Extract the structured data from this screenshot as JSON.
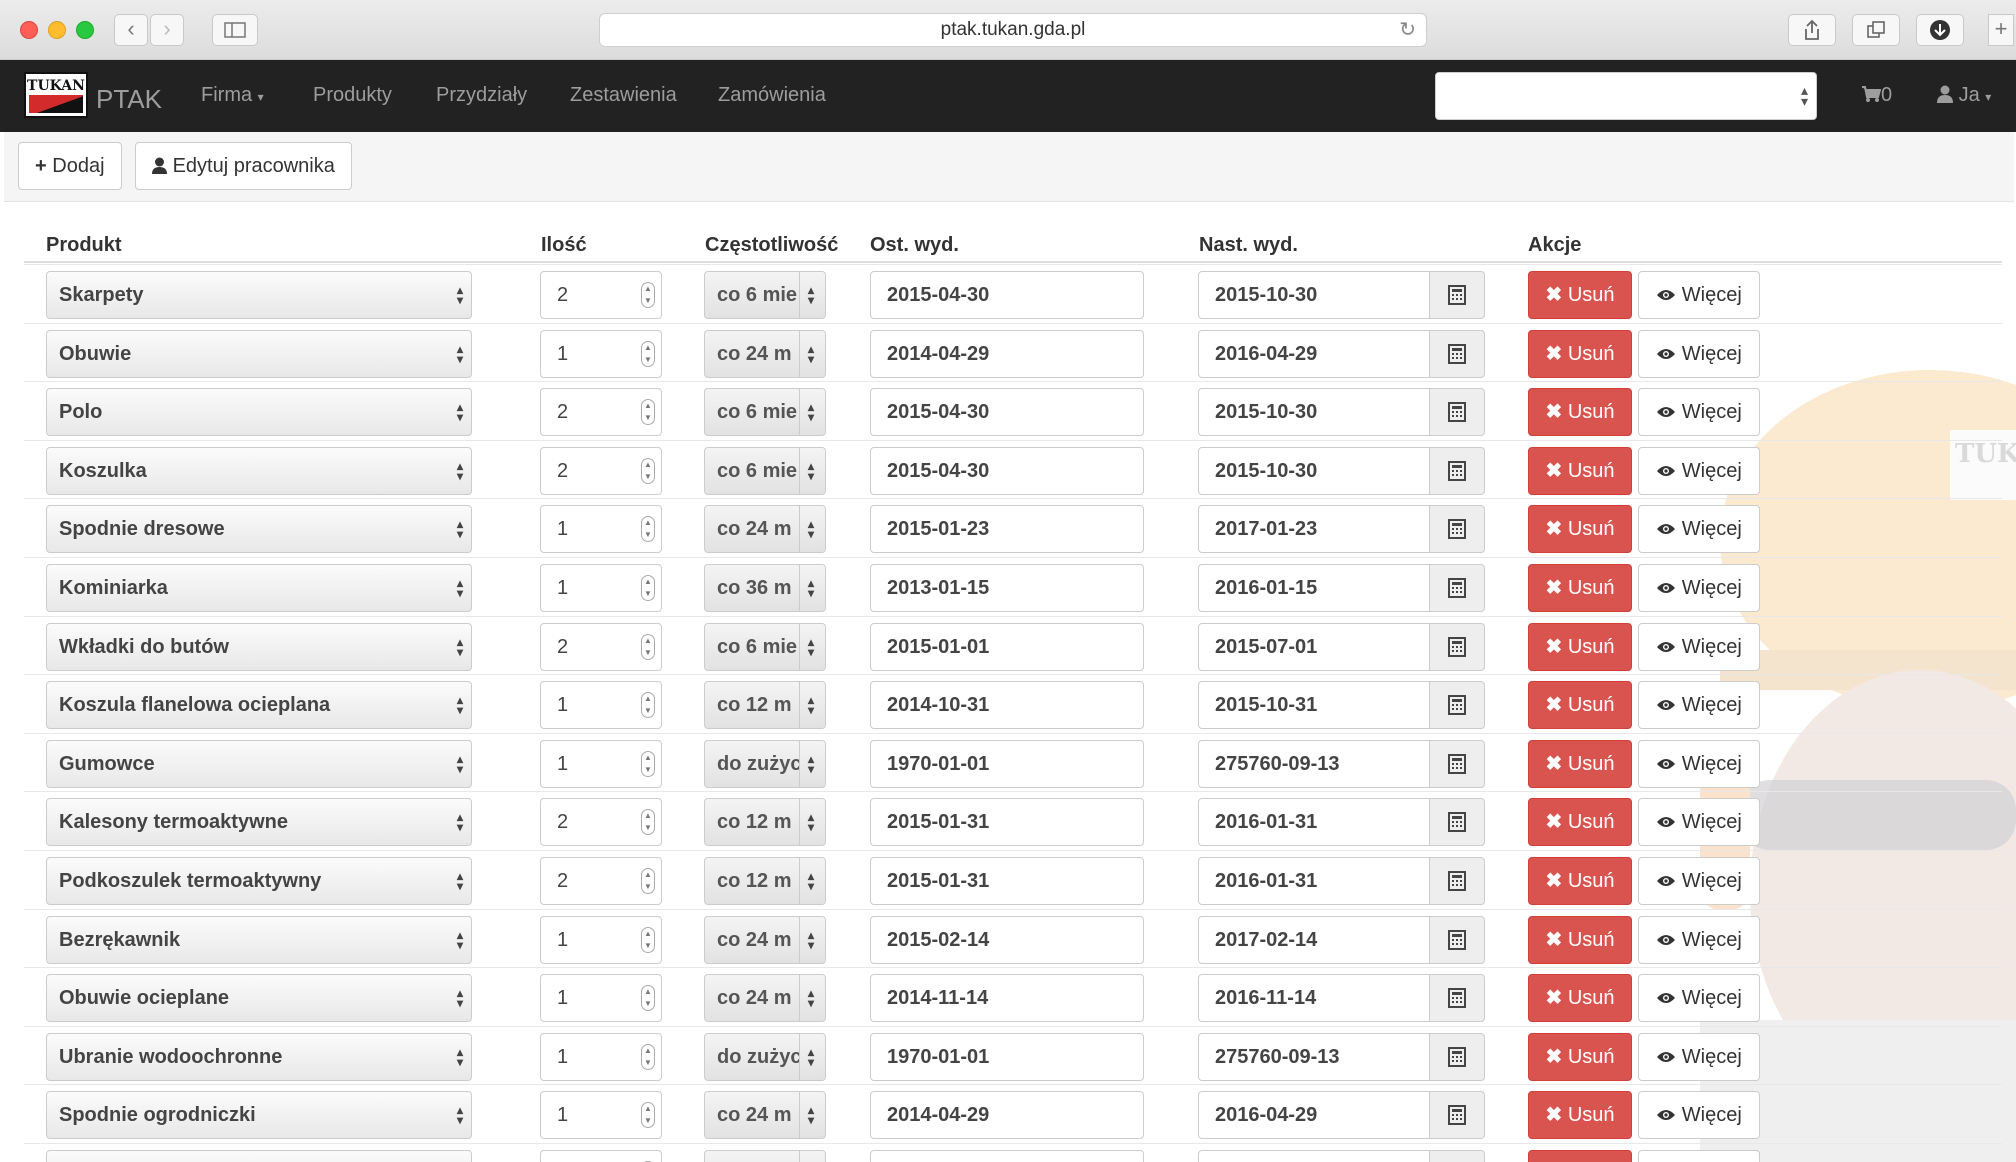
{
  "browser": {
    "url": "ptak.tukan.gda.pl",
    "back_icon": "chevron-left-icon",
    "forward_icon": "chevron-right-icon",
    "reload_icon": "reload-icon"
  },
  "navbar": {
    "logo_text": "TUKAN",
    "brand": "PTAK",
    "items": [
      "Firma",
      "Produkty",
      "Przydziały",
      "Zestawienia",
      "Zamówienia"
    ],
    "cart_count": "0",
    "user_label": "Ja"
  },
  "toolbar": {
    "add_label": "Dodaj",
    "edit_label": "Edytuj pracownika"
  },
  "table": {
    "headers": {
      "product": "Produkt",
      "quantity": "Ilość",
      "frequency": "Częstotliwość",
      "last_issue": "Ost. wyd.",
      "next_issue": "Nast. wyd.",
      "actions": "Akcje"
    },
    "delete_label": "Usuń",
    "more_label": "Więcej",
    "rows": [
      {
        "product": "Skarpety",
        "qty": "2",
        "freq": "co 6 mie",
        "last": "2015-04-30",
        "next": "2015-10-30"
      },
      {
        "product": "Obuwie",
        "qty": "1",
        "freq": "co 24 m",
        "last": "2014-04-29",
        "next": "2016-04-29"
      },
      {
        "product": "Polo",
        "qty": "2",
        "freq": "co 6 mie",
        "last": "2015-04-30",
        "next": "2015-10-30"
      },
      {
        "product": "Koszulka",
        "qty": "2",
        "freq": "co 6 mie",
        "last": "2015-04-30",
        "next": "2015-10-30"
      },
      {
        "product": "Spodnie dresowe",
        "qty": "1",
        "freq": "co 24 m",
        "last": "2015-01-23",
        "next": "2017-01-23"
      },
      {
        "product": "Kominiarka",
        "qty": "1",
        "freq": "co 36 m",
        "last": "2013-01-15",
        "next": "2016-01-15"
      },
      {
        "product": "Wkładki do butów",
        "qty": "2",
        "freq": "co 6 mie",
        "last": "2015-01-01",
        "next": "2015-07-01"
      },
      {
        "product": "Koszula flanelowa ocieplana",
        "qty": "1",
        "freq": "co 12 m",
        "last": "2014-10-31",
        "next": "2015-10-31"
      },
      {
        "product": "Gumowce",
        "qty": "1",
        "freq": "do zużyc",
        "last": "1970-01-01",
        "next": "275760-09-13"
      },
      {
        "product": "Kalesony termoaktywne",
        "qty": "2",
        "freq": "co 12 m",
        "last": "2015-01-31",
        "next": "2016-01-31"
      },
      {
        "product": "Podkoszulek termoaktywny",
        "qty": "2",
        "freq": "co 12 m",
        "last": "2015-01-31",
        "next": "2016-01-31"
      },
      {
        "product": "Bezrękawnik",
        "qty": "1",
        "freq": "co 24 m",
        "last": "2015-02-14",
        "next": "2017-02-14"
      },
      {
        "product": "Obuwie ocieplane",
        "qty": "1",
        "freq": "co 24 m",
        "last": "2014-11-14",
        "next": "2016-11-14"
      },
      {
        "product": "Ubranie wodoochronne",
        "qty": "1",
        "freq": "do zużyc",
        "last": "1970-01-01",
        "next": "275760-09-13"
      },
      {
        "product": "Spodnie ogrodniczki",
        "qty": "1",
        "freq": "co 24 m",
        "last": "2014-04-29",
        "next": "2016-04-29"
      }
    ]
  },
  "colors": {
    "navbar_bg": "#222222",
    "danger": "#d9534f",
    "accent_helmet": "#f0a030"
  }
}
